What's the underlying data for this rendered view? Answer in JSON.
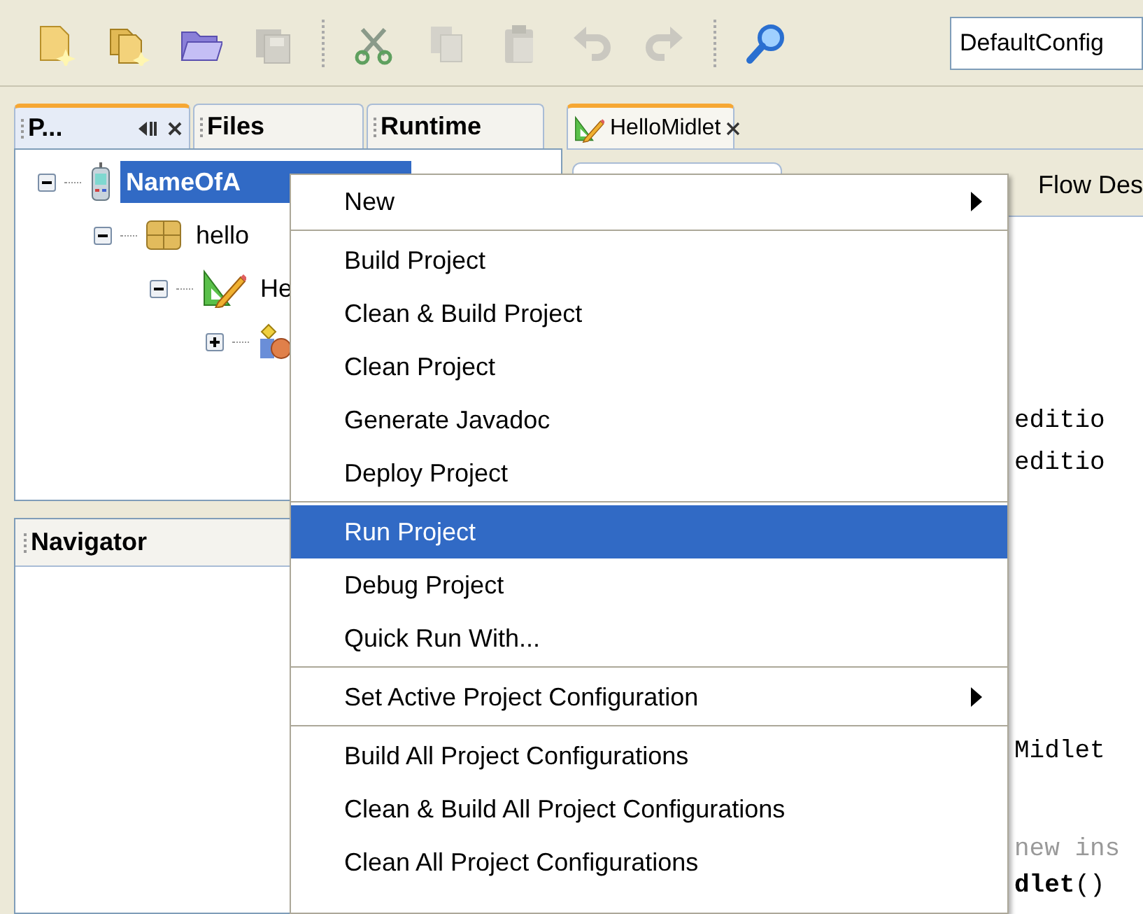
{
  "toolbar": {
    "buttons": [
      {
        "disabled": false
      },
      {
        "disabled": false
      },
      {
        "disabled": false
      },
      {
        "disabled": true
      },
      {
        "disabled": false
      },
      {
        "disabled": true
      },
      {
        "disabled": true
      },
      {
        "disabled": true
      },
      {
        "disabled": true
      },
      {
        "disabled": false
      }
    ],
    "configuration": "DefaultConfig"
  },
  "left_tabs": [
    {
      "label": "P...",
      "selected": true
    },
    {
      "label": "Files",
      "selected": false
    },
    {
      "label": "Runtime",
      "selected": false
    }
  ],
  "tree": [
    {
      "label": "NameOfA",
      "kind": "project",
      "selected": true,
      "expanded": true,
      "children": [
        {
          "label": "hello",
          "kind": "package",
          "selected": false,
          "expanded": true,
          "children": [
            {
              "label": "He",
              "kind": "midlet",
              "selected": false,
              "expanded": true,
              "children": [
                {
                  "kind": "class",
                  "expanded": false
                }
              ]
            }
          ]
        }
      ]
    }
  ],
  "navigator": {
    "title": "Navigator"
  },
  "editor_tabs": [
    {
      "label": "HelloMidlet",
      "selected": true
    }
  ],
  "editor_subtab": "Flow Des",
  "code_lines": [
    "editio",
    "editio",
    "Midlet",
    "new ins",
    "**dlet**()"
  ],
  "context_menu": {
    "groups": [
      [
        {
          "label": "New",
          "submenu": true,
          "selected": false
        }
      ],
      [
        {
          "label": "Build Project",
          "submenu": false,
          "selected": false
        },
        {
          "label": "Clean & Build Project",
          "submenu": false,
          "selected": false
        },
        {
          "label": "Clean Project",
          "submenu": false,
          "selected": false
        },
        {
          "label": "Generate Javadoc",
          "submenu": false,
          "selected": false
        },
        {
          "label": "Deploy Project",
          "submenu": false,
          "selected": false
        }
      ],
      [
        {
          "label": "Run Project",
          "submenu": false,
          "selected": true
        },
        {
          "label": "Debug Project",
          "submenu": false,
          "selected": false
        },
        {
          "label": "Quick Run With...",
          "submenu": false,
          "selected": false
        }
      ],
      [
        {
          "label": "Set Active Project Configuration",
          "submenu": true,
          "selected": false
        }
      ],
      [
        {
          "label": "Build All Project Configurations",
          "submenu": false,
          "selected": false
        },
        {
          "label": "Clean & Build All Project Configurations",
          "submenu": false,
          "selected": false
        },
        {
          "label": "Clean All Project Configurations",
          "submenu": false,
          "selected": false
        }
      ]
    ]
  }
}
